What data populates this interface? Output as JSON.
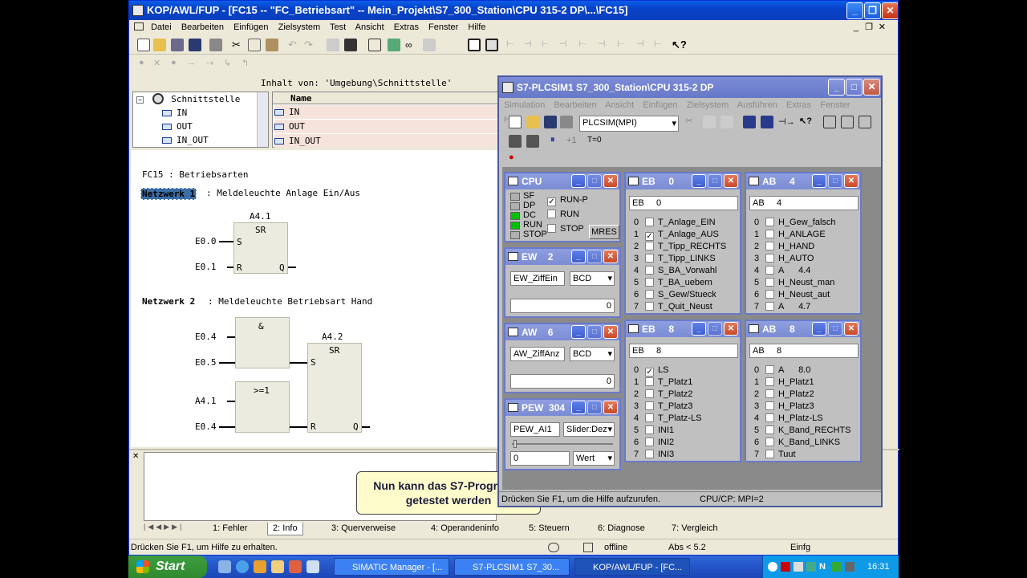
{
  "main_window": {
    "title": "KOP/AWL/FUP  - [FC15 -- \"FC_Betriebsart\" -- Mein_Projekt\\S7_300_Station\\CPU 315-2 DP\\...\\FC15]",
    "menu": [
      "Datei",
      "Bearbeiten",
      "Einfügen",
      "Zielsystem",
      "Test",
      "Ansicht",
      "Extras",
      "Fenster",
      "Hilfe"
    ],
    "interface_header": "Inhalt von: 'Umgebung\\Schnittstelle'",
    "tree": {
      "root": "Schnittstelle",
      "items": [
        "IN",
        "OUT",
        "IN_OUT"
      ]
    },
    "table": {
      "col_name": "Name",
      "rows": [
        "IN",
        "OUT",
        "IN_OUT"
      ]
    },
    "block_title": "FC15 : Betriebsarten",
    "network1": {
      "label": "Netzwerk 1",
      "comment": ": Meldeleuchte Anlage Ein/Aus",
      "sr_address": "A4.1",
      "sr_label": "SR",
      "pin_s": "S",
      "pin_r": "R",
      "pin_q": "Q",
      "input_s": "E0.0",
      "input_r": "E0.1"
    },
    "network2": {
      "label": "Netzwerk 2",
      "comment": ": Meldeleuchte Betriebsart Hand",
      "and_label": "&",
      "or_label": ">=1",
      "sr_address": "A4.2",
      "sr_label": "SR",
      "pin_s": "S",
      "pin_r": "R",
      "pin_q": "Q",
      "and_in1": "E0.4",
      "and_in2": "E0.5",
      "or_in1": "A4.1",
      "or_in2": "E0.4"
    },
    "callout": "Nun kann das S7-Programm getestet werden",
    "tabs": [
      "1: Fehler",
      "2: Info",
      "3: Querverweise",
      "4: Operandeninfo",
      "5: Steuern",
      "6: Diagnose",
      "7: Vergleich"
    ],
    "status": {
      "help": "Drücken Sie F1, um Hilfe zu erhalten.",
      "mode": "offline",
      "abs": "Abs < 5.2",
      "insert": "Einfg"
    }
  },
  "plcsim": {
    "title": "S7-PLCSIM1    S7_300_Station\\CPU 315-2 DP",
    "menu": [
      "Simulation",
      "Bearbeiten",
      "Ansicht",
      "Einfügen",
      "Zielsystem",
      "Ausführen",
      "Extras",
      "Fenster",
      "Hilfe"
    ],
    "connection": "PLCSIM(MPI)",
    "step_label": "+1",
    "reset_label": "T=0",
    "status_left": "Drücken Sie F1, um die Hilfe aufzurufen.",
    "status_right": "CPU/CP:  MPI=2",
    "cpu": {
      "title": "CPU",
      "leds": [
        "SF",
        "DP",
        "DC",
        "RUN",
        "STOP"
      ],
      "modes": [
        "RUN-P",
        "RUN",
        "STOP"
      ],
      "mres": "MRES",
      "led_colors": {
        "off": "#b0b0b0",
        "on": "#00c000"
      }
    },
    "ew": {
      "title": "EW",
      "addr": "2",
      "var": "EW_ZiffEin",
      "format": "BCD",
      "value": "0"
    },
    "aw": {
      "title": "AW",
      "addr": "6",
      "var": "AW_ZiffAnz",
      "format": "BCD",
      "value": "0"
    },
    "pew": {
      "title": "PEW",
      "addr": "304",
      "var": "PEW_AI1",
      "format": "Slider:Dez",
      "value": "0",
      "unit": "Wert"
    },
    "eb0": {
      "title": "EB",
      "addr": "0",
      "field": "EB     0",
      "bits": [
        {
          "n": "0",
          "label": "T_Anlage_EIN",
          "checked": false
        },
        {
          "n": "1",
          "label": "T_Anlage_AUS",
          "checked": true
        },
        {
          "n": "2",
          "label": "T_Tipp_RECHTS",
          "checked": false
        },
        {
          "n": "3",
          "label": "T_Tipp_LINKS",
          "checked": false
        },
        {
          "n": "4",
          "label": "S_BA_Vorwahl",
          "checked": false
        },
        {
          "n": "5",
          "label": "T_BA_uebern",
          "checked": false
        },
        {
          "n": "6",
          "label": "S_Gew/Stueck",
          "checked": false
        },
        {
          "n": "7",
          "label": "T_Quit_Neust",
          "checked": false
        }
      ]
    },
    "ab4": {
      "title": "AB",
      "addr": "4",
      "field": "AB     4",
      "bits": [
        {
          "n": "0",
          "label": "H_Gew_falsch",
          "checked": false
        },
        {
          "n": "1",
          "label": "H_ANLAGE",
          "checked": false
        },
        {
          "n": "2",
          "label": "H_HAND",
          "checked": false
        },
        {
          "n": "3",
          "label": "H_AUTO",
          "checked": false
        },
        {
          "n": "4",
          "label": "A      4.4",
          "checked": false
        },
        {
          "n": "5",
          "label": "H_Neust_man",
          "checked": false
        },
        {
          "n": "6",
          "label": "H_Neust_aut",
          "checked": false
        },
        {
          "n": "7",
          "label": "A      4.7",
          "checked": false
        }
      ]
    },
    "eb8": {
      "title": "EB",
      "addr": "8",
      "field": "EB     8",
      "bits": [
        {
          "n": "0",
          "label": "LS",
          "checked": true
        },
        {
          "n": "1",
          "label": "T_Platz1",
          "checked": false
        },
        {
          "n": "2",
          "label": "T_Platz2",
          "checked": false
        },
        {
          "n": "3",
          "label": "T_Platz3",
          "checked": false
        },
        {
          "n": "4",
          "label": "T_Platz-LS",
          "checked": false
        },
        {
          "n": "5",
          "label": "INI1",
          "checked": false
        },
        {
          "n": "6",
          "label": "INI2",
          "checked": false
        },
        {
          "n": "7",
          "label": "INI3",
          "checked": false
        }
      ]
    },
    "ab8": {
      "title": "AB",
      "addr": "8",
      "field": "AB     8",
      "bits": [
        {
          "n": "0",
          "label": "A      8.0",
          "checked": false
        },
        {
          "n": "1",
          "label": "H_Platz1",
          "checked": false
        },
        {
          "n": "2",
          "label": "H_Platz2",
          "checked": false
        },
        {
          "n": "3",
          "label": "H_Platz3",
          "checked": false
        },
        {
          "n": "4",
          "label": "H_Platz-LS",
          "checked": false
        },
        {
          "n": "5",
          "label": "K_Band_RECHTS",
          "checked": false
        },
        {
          "n": "6",
          "label": "K_Band_LINKS",
          "checked": false
        },
        {
          "n": "7",
          "label": "Tuut",
          "checked": false
        }
      ]
    }
  },
  "taskbar": {
    "start": "Start",
    "tasks": [
      "SIMATIC Manager - [...",
      "S7-PLCSIM1    S7_30...",
      "KOP/AWL/FUP - [FC..."
    ],
    "clock": "16:31"
  }
}
